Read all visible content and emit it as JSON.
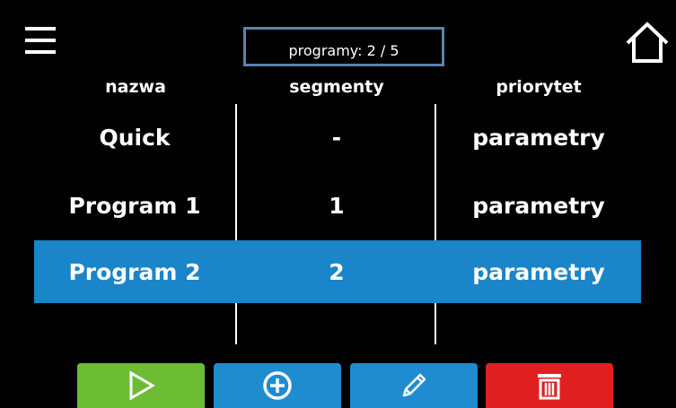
{
  "header": {
    "counter_label": "programy: 2 / 5",
    "menu_icon": "menu-icon",
    "home_icon": "home-icon",
    "counter_border_color": "#5c82ad"
  },
  "columns": {
    "name": "nazwa",
    "segments": "segmenty",
    "priority": "priorytet"
  },
  "rows": [
    {
      "name": "Quick",
      "segments": "-",
      "priority": "parametry",
      "selected": false
    },
    {
      "name": "Program 1",
      "segments": "1",
      "priority": "parametry",
      "selected": false
    },
    {
      "name": "Program 2",
      "segments": "2",
      "priority": "parametry",
      "selected": true
    }
  ],
  "toolbar": {
    "buttons": [
      {
        "name": "start-program-button",
        "icon": "play-icon",
        "color": "#6cbc34"
      },
      {
        "name": "add-program-button",
        "icon": "plus-circle-icon",
        "color": "#1f8ccf"
      },
      {
        "name": "edit-program-button",
        "icon": "pencil-icon",
        "color": "#1f8ccf"
      },
      {
        "name": "delete-program-button",
        "icon": "trash-icon",
        "color": "#e02020"
      }
    ]
  },
  "colors": {
    "background": "#000000",
    "selected_row": "#1a85c8",
    "text": "#ffffff"
  }
}
